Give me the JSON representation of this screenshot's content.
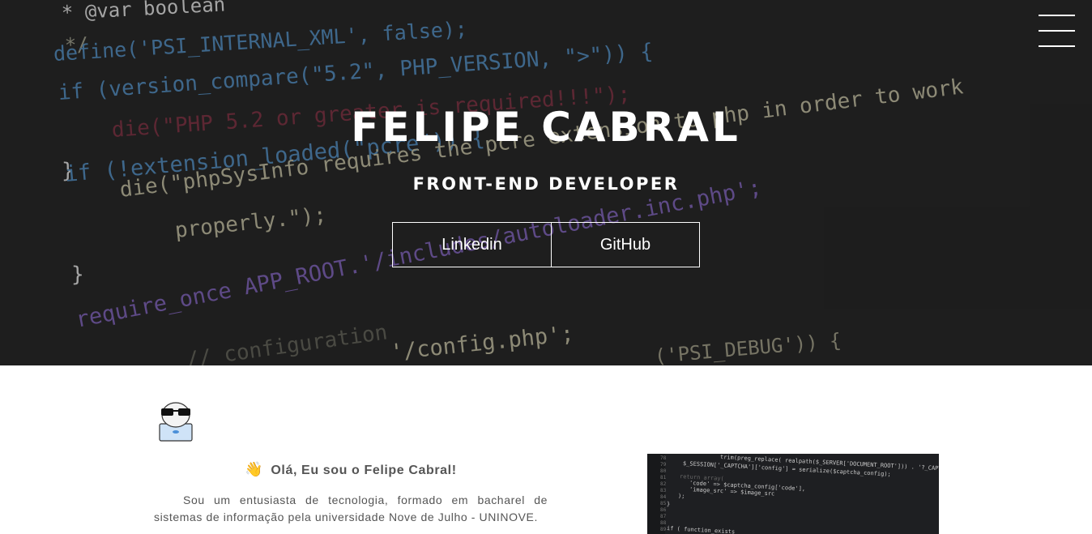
{
  "hero": {
    "title": "FELIPE CABRAL",
    "subtitle": "FRONT-END DEVELOPER",
    "buttons": {
      "linkedin": "Linkedin",
      "github": "GitHub"
    },
    "menu_icon": "hamburger-menu-icon",
    "background_code": [
      "* @var boolean",
      "*/",
      "define('PSI_INTERNAL_XML', false);",
      "if (version_compare(\"5.2\", PHP_VERSION, \">\")) {",
      "die(\"PHP 5.2 or greater is required!!!\");",
      "}",
      "if (!extension_loaded(\"pcre\")) {",
      "die(\"phpSysInfo requires the pcre extension to php in order to work",
      "properly.\");",
      "}",
      "require_once APP_ROOT.'/includes/autoloader.inc.php';",
      "// configuration",
      "'/config.php';",
      "('PSI_DEBUG')) {"
    ]
  },
  "about": {
    "avatar_icon": "developer-avatar-icon",
    "wave_emoji": "👋",
    "greeting": "Olá, Eu sou o Felipe Cabral!",
    "paragraph": "Sou um entusiasta de tecnologia, formado em bacharel de sistemas de informação pela universidade Nove de Julho - UNINOVE."
  },
  "code_image": {
    "lines": [
      "trim(preg_replace( realpath($_SERVER['DOCUMENT_ROOT'])) . '?_CAPT",
      "$_SESSION['_CAPTCHA']['config'] = serialize($captcha_config);",
      "return array(",
      "'code' => $captcha_config['code'],",
      "'image_src' => $image_src",
      ");",
      "}",
      "",
      "if ( function_exists"
    ],
    "line_numbers": [
      "78",
      "79",
      "80",
      "81",
      "82",
      "83",
      "84",
      "85",
      "86",
      "87",
      "88",
      "89"
    ]
  },
  "colors": {
    "hero_bg": "#242424",
    "text_white": "#ffffff",
    "body_text": "#555555"
  }
}
